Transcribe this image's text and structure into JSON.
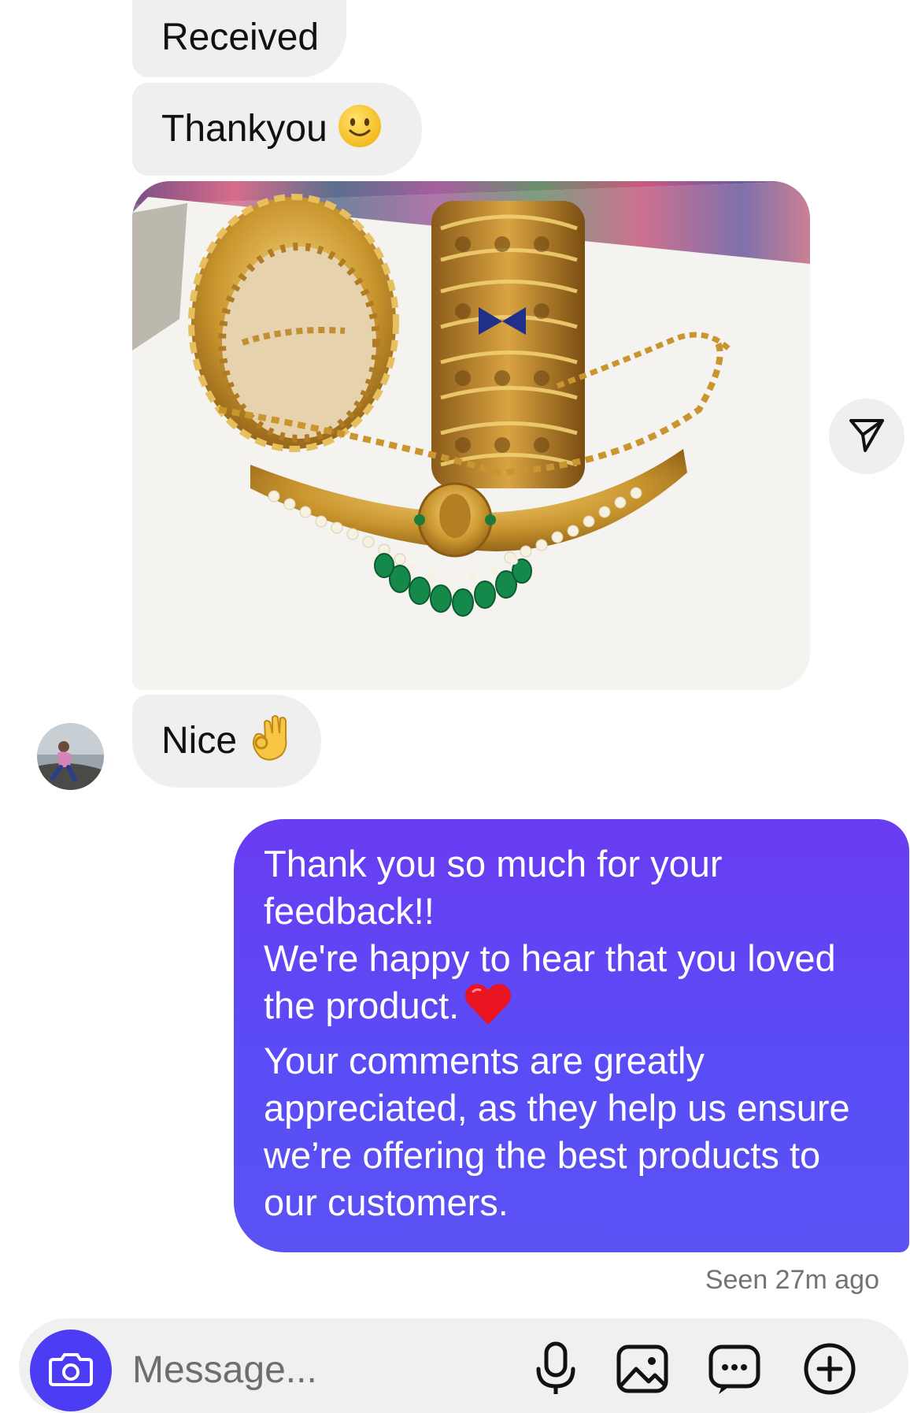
{
  "messages": {
    "received_1": {
      "text": "Received"
    },
    "received_2": {
      "text": "Thankyou",
      "emoji": "slightly-smiling-face"
    },
    "received_photo": {
      "description_icon": "jewelry-photo"
    },
    "received_3": {
      "text": "Nice",
      "emoji": "ok-hand"
    },
    "sent_1": {
      "lines": [
        "Thank you so much for your",
        "feedback!!",
        "We're happy to hear that you loved",
        "the product.",
        "Your comments are greatly",
        "appreciated, as they help us ensure",
        "we’re offering the best products to",
        "our customers."
      ],
      "emoji": "red-heart"
    }
  },
  "status": {
    "seen": "Seen 27m ago"
  },
  "composer": {
    "placeholder": "Message..."
  },
  "icons": [
    "share-icon",
    "camera-icon",
    "microphone-icon",
    "gallery-icon",
    "sticker-icon",
    "plus-icon"
  ],
  "colors": {
    "sent_bubble": "#5b4cf5",
    "received_bubble": "#efefef",
    "accent": "#4c3cf3",
    "muted_text": "#737373"
  }
}
